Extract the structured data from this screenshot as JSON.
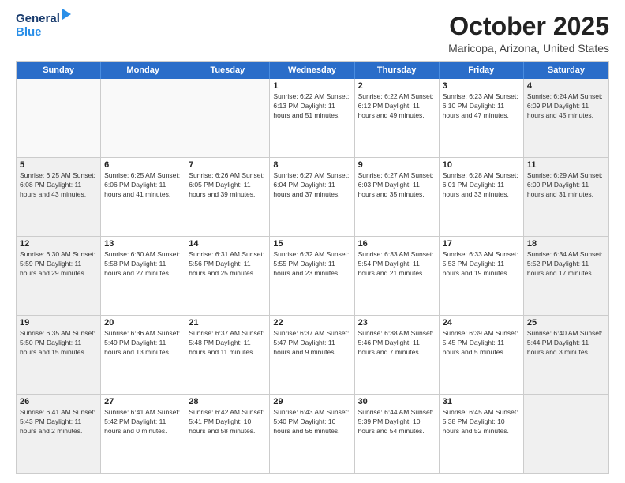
{
  "header": {
    "logo_general": "General",
    "logo_blue": "Blue",
    "month_year": "October 2025",
    "location": "Maricopa, Arizona, United States"
  },
  "days_of_week": [
    "Sunday",
    "Monday",
    "Tuesday",
    "Wednesday",
    "Thursday",
    "Friday",
    "Saturday"
  ],
  "weeks": [
    [
      {
        "day": "",
        "info": "",
        "empty": true
      },
      {
        "day": "",
        "info": "",
        "empty": true
      },
      {
        "day": "",
        "info": "",
        "empty": true
      },
      {
        "day": "1",
        "info": "Sunrise: 6:22 AM\nSunset: 6:13 PM\nDaylight: 11 hours\nand 51 minutes."
      },
      {
        "day": "2",
        "info": "Sunrise: 6:22 AM\nSunset: 6:12 PM\nDaylight: 11 hours\nand 49 minutes."
      },
      {
        "day": "3",
        "info": "Sunrise: 6:23 AM\nSunset: 6:10 PM\nDaylight: 11 hours\nand 47 minutes."
      },
      {
        "day": "4",
        "info": "Sunrise: 6:24 AM\nSunset: 6:09 PM\nDaylight: 11 hours\nand 45 minutes.",
        "shaded": true
      }
    ],
    [
      {
        "day": "5",
        "info": "Sunrise: 6:25 AM\nSunset: 6:08 PM\nDaylight: 11 hours\nand 43 minutes.",
        "shaded": true
      },
      {
        "day": "6",
        "info": "Sunrise: 6:25 AM\nSunset: 6:06 PM\nDaylight: 11 hours\nand 41 minutes."
      },
      {
        "day": "7",
        "info": "Sunrise: 6:26 AM\nSunset: 6:05 PM\nDaylight: 11 hours\nand 39 minutes."
      },
      {
        "day": "8",
        "info": "Sunrise: 6:27 AM\nSunset: 6:04 PM\nDaylight: 11 hours\nand 37 minutes."
      },
      {
        "day": "9",
        "info": "Sunrise: 6:27 AM\nSunset: 6:03 PM\nDaylight: 11 hours\nand 35 minutes."
      },
      {
        "day": "10",
        "info": "Sunrise: 6:28 AM\nSunset: 6:01 PM\nDaylight: 11 hours\nand 33 minutes."
      },
      {
        "day": "11",
        "info": "Sunrise: 6:29 AM\nSunset: 6:00 PM\nDaylight: 11 hours\nand 31 minutes.",
        "shaded": true
      }
    ],
    [
      {
        "day": "12",
        "info": "Sunrise: 6:30 AM\nSunset: 5:59 PM\nDaylight: 11 hours\nand 29 minutes.",
        "shaded": true
      },
      {
        "day": "13",
        "info": "Sunrise: 6:30 AM\nSunset: 5:58 PM\nDaylight: 11 hours\nand 27 minutes."
      },
      {
        "day": "14",
        "info": "Sunrise: 6:31 AM\nSunset: 5:56 PM\nDaylight: 11 hours\nand 25 minutes."
      },
      {
        "day": "15",
        "info": "Sunrise: 6:32 AM\nSunset: 5:55 PM\nDaylight: 11 hours\nand 23 minutes."
      },
      {
        "day": "16",
        "info": "Sunrise: 6:33 AM\nSunset: 5:54 PM\nDaylight: 11 hours\nand 21 minutes."
      },
      {
        "day": "17",
        "info": "Sunrise: 6:33 AM\nSunset: 5:53 PM\nDaylight: 11 hours\nand 19 minutes."
      },
      {
        "day": "18",
        "info": "Sunrise: 6:34 AM\nSunset: 5:52 PM\nDaylight: 11 hours\nand 17 minutes.",
        "shaded": true
      }
    ],
    [
      {
        "day": "19",
        "info": "Sunrise: 6:35 AM\nSunset: 5:50 PM\nDaylight: 11 hours\nand 15 minutes.",
        "shaded": true
      },
      {
        "day": "20",
        "info": "Sunrise: 6:36 AM\nSunset: 5:49 PM\nDaylight: 11 hours\nand 13 minutes."
      },
      {
        "day": "21",
        "info": "Sunrise: 6:37 AM\nSunset: 5:48 PM\nDaylight: 11 hours\nand 11 minutes."
      },
      {
        "day": "22",
        "info": "Sunrise: 6:37 AM\nSunset: 5:47 PM\nDaylight: 11 hours\nand 9 minutes."
      },
      {
        "day": "23",
        "info": "Sunrise: 6:38 AM\nSunset: 5:46 PM\nDaylight: 11 hours\nand 7 minutes."
      },
      {
        "day": "24",
        "info": "Sunrise: 6:39 AM\nSunset: 5:45 PM\nDaylight: 11 hours\nand 5 minutes."
      },
      {
        "day": "25",
        "info": "Sunrise: 6:40 AM\nSunset: 5:44 PM\nDaylight: 11 hours\nand 3 minutes.",
        "shaded": true
      }
    ],
    [
      {
        "day": "26",
        "info": "Sunrise: 6:41 AM\nSunset: 5:43 PM\nDaylight: 11 hours\nand 2 minutes.",
        "shaded": true
      },
      {
        "day": "27",
        "info": "Sunrise: 6:41 AM\nSunset: 5:42 PM\nDaylight: 11 hours\nand 0 minutes."
      },
      {
        "day": "28",
        "info": "Sunrise: 6:42 AM\nSunset: 5:41 PM\nDaylight: 10 hours\nand 58 minutes."
      },
      {
        "day": "29",
        "info": "Sunrise: 6:43 AM\nSunset: 5:40 PM\nDaylight: 10 hours\nand 56 minutes."
      },
      {
        "day": "30",
        "info": "Sunrise: 6:44 AM\nSunset: 5:39 PM\nDaylight: 10 hours\nand 54 minutes."
      },
      {
        "day": "31",
        "info": "Sunrise: 6:45 AM\nSunset: 5:38 PM\nDaylight: 10 hours\nand 52 minutes."
      },
      {
        "day": "",
        "info": "",
        "empty": true,
        "shaded": true
      }
    ]
  ]
}
